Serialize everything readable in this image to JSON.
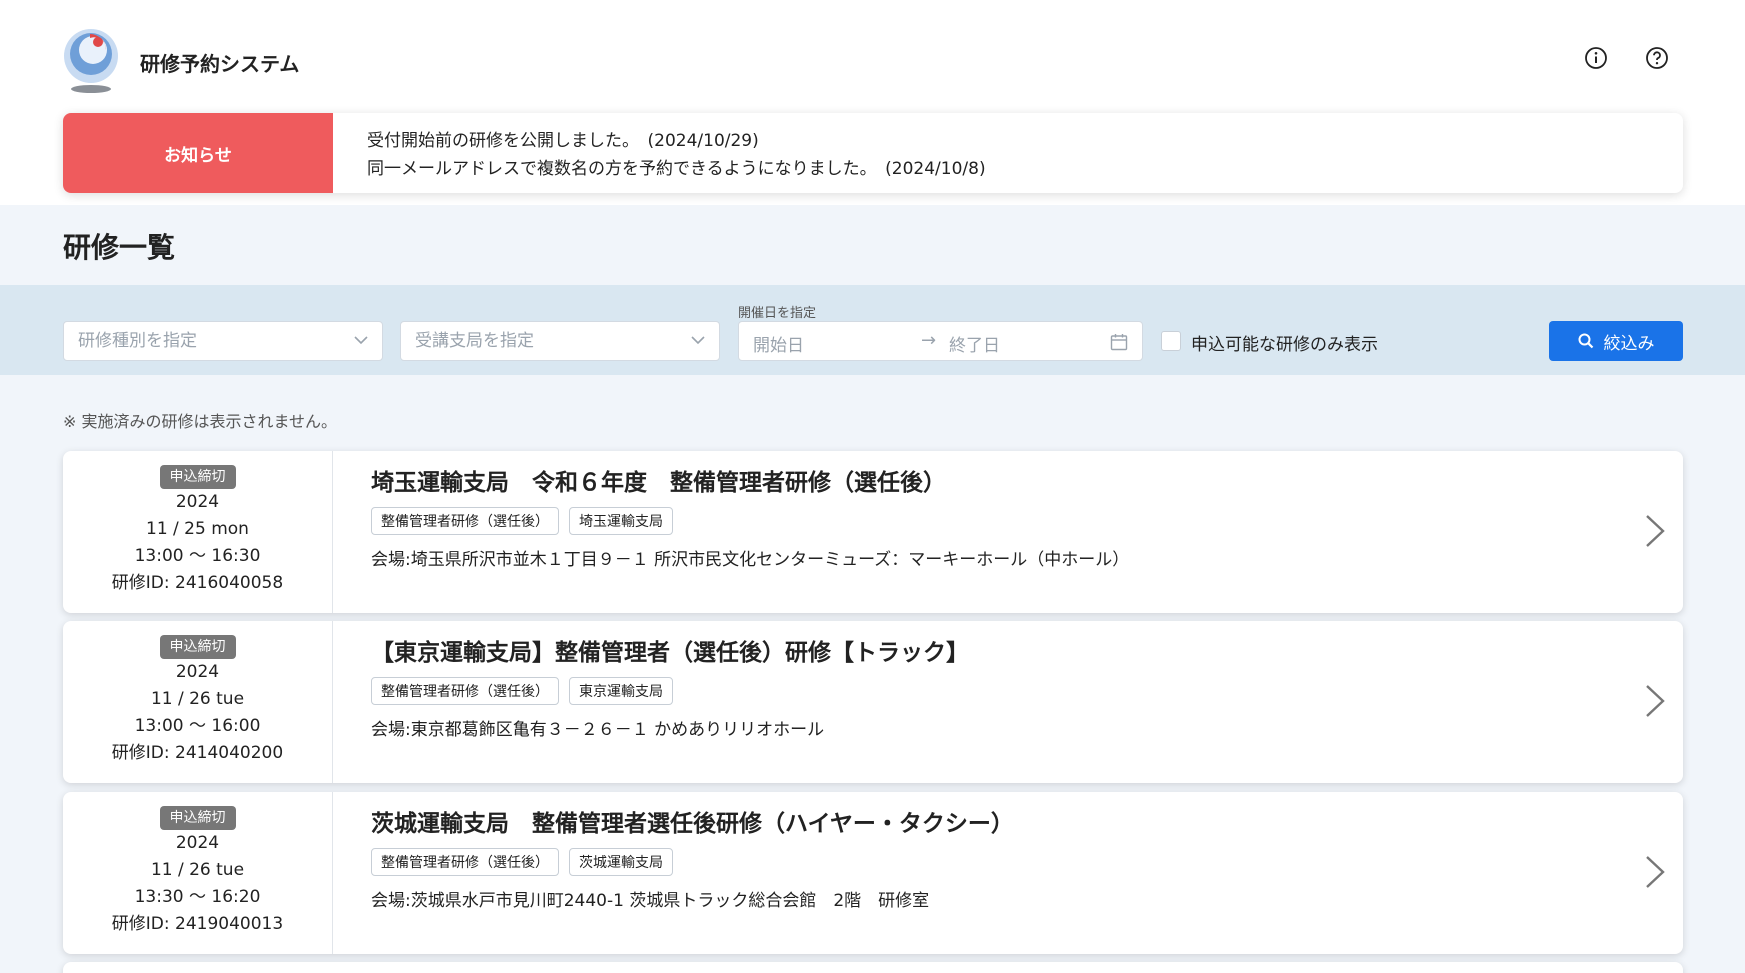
{
  "header": {
    "app_title": "研修予約システム"
  },
  "notice": {
    "label": "お知らせ",
    "items": [
      "受付開始前の研修を公開しました。　(2024/10/29)",
      "同一メールアドレスで複数名の方を予約できるようになりました。　(2024/10/8)"
    ]
  },
  "page": {
    "title": "研修一覧",
    "note": "※ 実施済みの研修は表示されません。"
  },
  "filters": {
    "kind_placeholder": "研修種別を指定",
    "branch_placeholder": "受講支局を指定",
    "date_label": "開催日を指定",
    "start_placeholder": "開始日",
    "end_placeholder": "終了日",
    "only_available_label": "申込可能な研修のみ表示",
    "only_available_checked": false,
    "submit_label": "絞込み"
  },
  "colors": {
    "notice_accent": "#ef5b5d",
    "primary": "#1a73e8",
    "badge": "#777777"
  },
  "courses": [
    {
      "status": "申込締切",
      "year": "2024",
      "date": "11 / 25  mon",
      "time": "13:00 〜 16:30",
      "id_label": "研修ID: 2416040058",
      "title": "埼玉運輸支局　令和６年度　整備管理者研修（選任後）",
      "tags": [
        "整備管理者研修（選任後）",
        "埼玉運輸支局"
      ],
      "venue": "会場:埼玉県所沢市並木１丁目９－１ 所沢市民文化センターミューズ：マーキーホール（中ホール）"
    },
    {
      "status": "申込締切",
      "year": "2024",
      "date": "11 / 26  tue",
      "time": "13:00 〜 16:00",
      "id_label": "研修ID: 2414040200",
      "title": "【東京運輸支局】整備管理者（選任後）研修【トラック】",
      "tags": [
        "整備管理者研修（選任後）",
        "東京運輸支局"
      ],
      "venue": "会場:東京都葛飾区亀有３－２６－１ かめありリリオホール"
    },
    {
      "status": "申込締切",
      "year": "2024",
      "date": "11 / 26  tue",
      "time": "13:30 〜 16:20",
      "id_label": "研修ID: 2419040013",
      "title": "茨城運輸支局　整備管理者選任後研修（ハイヤー・タクシー）",
      "tags": [
        "整備管理者研修（選任後）",
        "茨城運輸支局"
      ],
      "venue": "会場:茨城県水戸市見川町2440-1 茨城県トラック総合会館　2階　研修室"
    }
  ]
}
